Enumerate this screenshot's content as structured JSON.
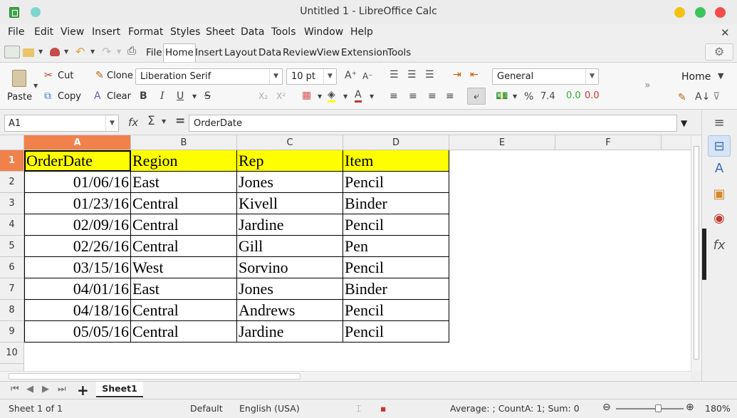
{
  "window": {
    "title": "Untitled 1 - LibreOffice Calc"
  },
  "menu": [
    "File",
    "Edit",
    "View",
    "Insert",
    "Format",
    "Styles",
    "Sheet",
    "Data",
    "Tools",
    "Window",
    "Help"
  ],
  "tabs": [
    "File",
    "Home",
    "Insert",
    "Layout",
    "Data",
    "Review",
    "View",
    "Extension",
    "Tools"
  ],
  "active_tab": "Home",
  "ribbon": {
    "paste": "Paste",
    "cut": "Cut",
    "copy": "Copy",
    "clone": "Clone",
    "clear": "Clear",
    "font_name": "Liberation Serif",
    "font_size": "10 pt",
    "number_format": "General",
    "home_menu": "Home",
    "percent": "%",
    "decimal": "7.4",
    "add_decimal": "0.0",
    "del_decimal": "0.0",
    "bold": "B",
    "italic": "I",
    "underline": "U",
    "strike": "S"
  },
  "formula_bar": {
    "cell_ref": "A1",
    "content": "OrderDate",
    "fx": "fx",
    "sigma": "Σ",
    "equals": "="
  },
  "columns": [
    "A",
    "B",
    "C",
    "D",
    "E",
    "F"
  ],
  "rows": [
    "1",
    "2",
    "3",
    "4",
    "5",
    "6",
    "7",
    "8",
    "9",
    "10"
  ],
  "table": {
    "headers": [
      "OrderDate",
      "Region",
      "Rep",
      "Item"
    ],
    "data": [
      [
        "01/06/16",
        "East",
        "Jones",
        "Pencil"
      ],
      [
        "01/23/16",
        "Central",
        "Kivell",
        "Binder"
      ],
      [
        "02/09/16",
        "Central",
        "Jardine",
        "Pencil"
      ],
      [
        "02/26/16",
        "Central",
        "Gill",
        "Pen"
      ],
      [
        "03/15/16",
        "West",
        "Sorvino",
        "Pencil"
      ],
      [
        "04/01/16",
        "East",
        "Jones",
        "Binder"
      ],
      [
        "04/18/16",
        "Central",
        "Andrews",
        "Pencil"
      ],
      [
        "05/05/16",
        "Central",
        "Jardine",
        "Pencil"
      ]
    ]
  },
  "sheet_tab": "Sheet1",
  "status": {
    "sheet": "Sheet 1 of 1",
    "page_style": "Default",
    "language": "English (USA)",
    "summary": "Average: ; CountA: 1; Sum: 0",
    "zoom": "180%"
  },
  "colors": {
    "selected_header": "#f1814b",
    "table_header_fill": "#ffff00"
  }
}
